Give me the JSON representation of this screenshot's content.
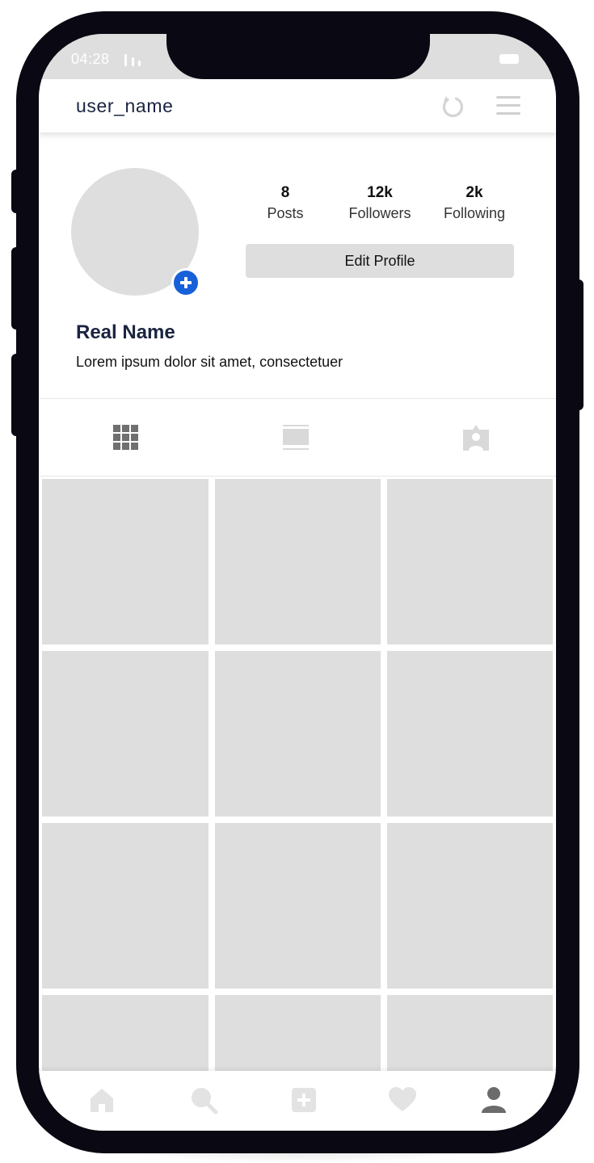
{
  "status_bar": {
    "time": "04:28",
    "signal_icon": "signal-bars-icon",
    "battery_icon": "battery-icon"
  },
  "header": {
    "username": "user_name",
    "refresh_icon": "refresh-icon",
    "menu_icon": "hamburger-menu-icon"
  },
  "profile": {
    "avatar_icon": "avatar-placeholder",
    "add_story_icon": "plus-circle-icon",
    "stats": [
      {
        "value": "8",
        "label": "Posts"
      },
      {
        "value": "12k",
        "label": "Followers"
      },
      {
        "value": "2k",
        "label": "Following"
      }
    ],
    "edit_button": "Edit Profile",
    "real_name": "Real Name",
    "bio": "Lorem ipsum dolor sit amet, consectetuer"
  },
  "tabs": [
    {
      "icon": "grid-icon",
      "active": true
    },
    {
      "icon": "feed-icon",
      "active": false
    },
    {
      "icon": "tagged-icon",
      "active": false
    }
  ],
  "photo_grid": {
    "rows": 4,
    "columns": 3,
    "cells": 12
  },
  "bottom_nav": [
    {
      "icon": "home-icon",
      "active": false
    },
    {
      "icon": "search-icon",
      "active": false
    },
    {
      "icon": "add-post-icon",
      "active": false
    },
    {
      "icon": "heart-icon",
      "active": false
    },
    {
      "icon": "profile-icon",
      "active": true
    }
  ],
  "colors": {
    "phone_frame": "#0a0812",
    "placeholder_gray": "#dedede",
    "accent_blue": "#1760d8",
    "text_dark": "#1b2440",
    "icon_gray": "#707070",
    "icon_light": "#d9d9d9"
  }
}
